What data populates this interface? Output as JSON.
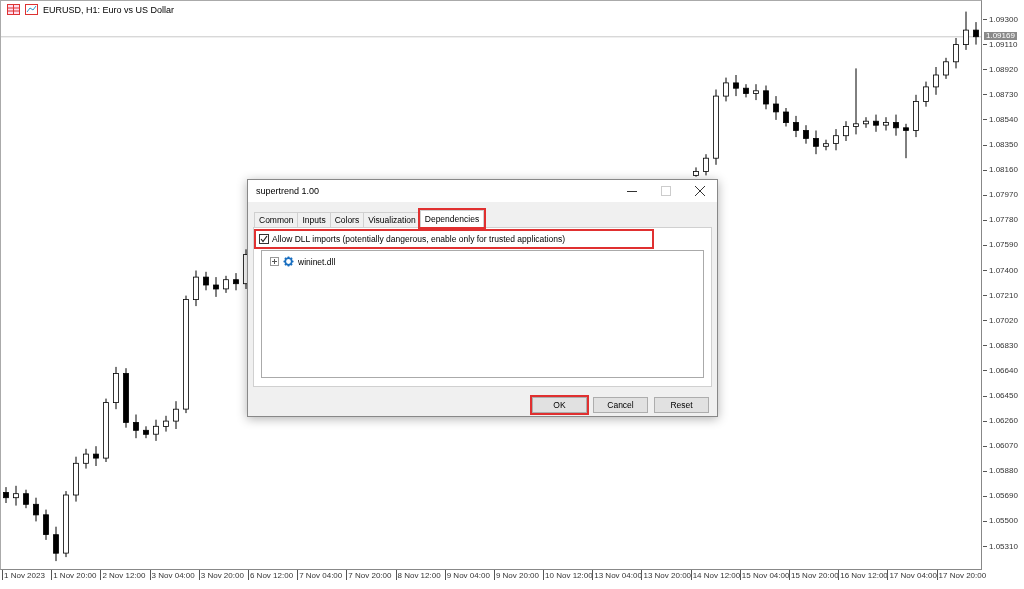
{
  "chart": {
    "title": "EURUSD, H1:  Euro vs US Dollar",
    "price_axis": {
      "current_price": "1.09169"
    },
    "time_axis": {
      "labels": [
        "1 Nov 2023",
        "1 Nov 20:00",
        "2 Nov 12:00",
        "3 Nov 04:00",
        "3 Nov 20:00",
        "6 Nov 12:00",
        "7 Nov 04:00",
        "7 Nov 20:00",
        "8 Nov 12:00",
        "9 Nov 04:00",
        "9 Nov 20:00",
        "10 Nov 12:00",
        "13 Nov 04:00",
        "13 Nov 20:00",
        "14 Nov 12:00",
        "15 Nov 04:00",
        "15 Nov 20:00",
        "16 Nov 12:00",
        "17 Nov 04:00",
        "17 Nov 20:00"
      ]
    },
    "chart_data": {
      "type": "candlestick",
      "ylim": [
        1.0514,
        1.0944
      ],
      "ref_lines": [
        {
          "axis": "y",
          "value": 1.09169
        }
      ],
      "yticks": [
        {
          "value": 1.093,
          "label": "1.09300"
        },
        {
          "value": 1.0911,
          "label": "1.09110"
        },
        {
          "value": 1.0892,
          "label": "1.08920"
        },
        {
          "value": 1.0873,
          "label": "1.08730"
        },
        {
          "value": 1.0854,
          "label": "1.08540"
        },
        {
          "value": 1.0835,
          "label": "1.08350"
        },
        {
          "value": 1.0816,
          "label": "1.08160"
        },
        {
          "value": 1.0797,
          "label": "1.07970"
        },
        {
          "value": 1.0778,
          "label": "1.07780"
        },
        {
          "value": 1.0759,
          "label": "1.07590"
        },
        {
          "value": 1.074,
          "label": "1.07400"
        },
        {
          "value": 1.0721,
          "label": "1.07210"
        },
        {
          "value": 1.0702,
          "label": "1.07020"
        },
        {
          "value": 1.0683,
          "label": "1.06830"
        },
        {
          "value": 1.0664,
          "label": "1.06640"
        },
        {
          "value": 1.0645,
          "label": "1.06450"
        },
        {
          "value": 1.0626,
          "label": "1.06260"
        },
        {
          "value": 1.0607,
          "label": "1.06070"
        },
        {
          "value": 1.0588,
          "label": "1.05880"
        },
        {
          "value": 1.0569,
          "label": "1.05690"
        },
        {
          "value": 1.055,
          "label": "1.05500"
        },
        {
          "value": 1.0531,
          "label": "1.05310"
        }
      ],
      "categories": [
        null,
        null,
        null,
        null,
        null,
        null,
        null,
        null,
        null,
        null,
        null,
        null,
        null,
        null,
        null,
        null,
        null,
        null,
        null,
        null,
        null,
        null,
        null,
        null,
        null,
        null,
        null,
        null,
        null,
        null,
        null,
        null,
        null,
        null,
        null,
        null,
        null,
        null,
        null,
        null,
        null,
        null,
        null,
        null,
        null,
        null,
        null,
        null,
        null,
        null,
        null,
        null,
        null,
        null,
        null,
        null,
        null,
        null,
        null,
        null,
        null,
        null,
        null,
        null,
        null,
        null,
        null,
        null,
        null,
        null,
        null,
        null,
        null,
        null,
        null,
        null,
        null,
        null,
        null,
        null,
        null,
        null,
        null,
        null,
        null,
        null,
        null,
        null,
        null,
        null,
        null,
        null,
        null,
        null,
        null,
        null,
        null,
        null
      ],
      "ohlc": [
        [
          1.0572,
          1.0576,
          1.0564,
          1.0568
        ],
        [
          1.0568,
          1.0577,
          1.0562,
          1.0571
        ],
        [
          1.0571,
          1.0574,
          1.056,
          1.0563
        ],
        [
          1.0563,
          1.0568,
          1.055,
          1.0555
        ],
        [
          1.0555,
          1.0559,
          1.0536,
          1.054
        ],
        [
          1.054,
          1.0546,
          1.052,
          1.0526
        ],
        [
          1.0526,
          1.0573,
          1.0523,
          1.057
        ],
        [
          1.057,
          1.0599,
          1.0565,
          1.0594
        ],
        [
          1.0594,
          1.0605,
          1.059,
          1.0601
        ],
        [
          1.0601,
          1.0607,
          1.0592,
          1.0598
        ],
        [
          1.0598,
          1.0643,
          1.0595,
          1.064
        ],
        [
          1.064,
          1.0667,
          1.0635,
          1.0662
        ],
        [
          1.0662,
          1.0666,
          1.0621,
          1.0625
        ],
        [
          1.0625,
          1.0631,
          1.0613,
          1.0619
        ],
        [
          1.0619,
          1.0622,
          1.0613,
          1.0616
        ],
        [
          1.0616,
          1.0627,
          1.0611,
          1.0622
        ],
        [
          1.0622,
          1.063,
          1.0618,
          1.0626
        ],
        [
          1.0626,
          1.0641,
          1.062,
          1.0635
        ],
        [
          1.0635,
          1.0721,
          1.0632,
          1.0718
        ],
        [
          1.0718,
          1.074,
          1.0713,
          1.0735
        ],
        [
          1.0735,
          1.0739,
          1.0725,
          1.0729
        ],
        [
          1.0729,
          1.0735,
          1.072,
          1.0726
        ],
        [
          1.0726,
          1.0736,
          1.0723,
          1.0733
        ],
        [
          1.0733,
          1.0738,
          1.0725,
          1.073
        ],
        [
          1.073,
          1.0756,
          1.0726,
          1.0752
        ],
        null,
        null,
        null,
        null,
        null,
        null,
        null,
        null,
        null,
        null,
        null,
        null,
        null,
        null,
        null,
        null,
        null,
        null,
        null,
        null,
        null,
        null,
        null,
        null,
        null,
        null,
        null,
        null,
        null,
        null,
        null,
        null,
        null,
        null,
        null,
        null,
        null,
        null,
        null,
        null,
        null,
        null,
        null,
        null,
        [
          1.0812,
          1.0818,
          1.0811,
          1.0815
        ],
        [
          1.0815,
          1.0828,
          1.0812,
          1.0825
        ],
        [
          1.0825,
          1.0877,
          1.082,
          1.0872
        ],
        [
          1.0872,
          1.0886,
          1.0868,
          1.0882
        ],
        [
          1.0882,
          1.0888,
          1.0872,
          1.0878
        ],
        [
          1.0878,
          1.0881,
          1.0871,
          1.0874
        ],
        [
          1.0874,
          1.0881,
          1.0869,
          1.0876
        ],
        [
          1.0876,
          1.088,
          1.0862,
          1.0866
        ],
        [
          1.0866,
          1.0872,
          1.0854,
          1.086
        ],
        [
          1.086,
          1.0863,
          1.0849,
          1.0852
        ],
        [
          1.0852,
          1.0857,
          1.0841,
          1.0846
        ],
        [
          1.0846,
          1.085,
          1.0836,
          1.084
        ],
        [
          1.084,
          1.0846,
          1.0828,
          1.0834
        ],
        [
          1.0834,
          1.0839,
          1.0831,
          1.0836
        ],
        [
          1.0836,
          1.0847,
          1.0831,
          1.0842
        ],
        [
          1.0842,
          1.0853,
          1.0838,
          1.0849
        ],
        [
          1.0849,
          1.0893,
          1.0843,
          1.0851
        ],
        [
          1.0851,
          1.0856,
          1.0848,
          1.0853
        ],
        [
          1.0853,
          1.0858,
          1.0845,
          1.085
        ],
        [
          1.085,
          1.0856,
          1.0846,
          1.0852
        ],
        [
          1.0852,
          1.0858,
          1.0842,
          1.0848
        ],
        [
          1.0848,
          1.0851,
          1.0825,
          1.0846
        ],
        [
          1.0846,
          1.0873,
          1.0841,
          1.0868
        ],
        [
          1.0868,
          1.0883,
          1.0864,
          1.0879
        ],
        [
          1.0879,
          1.0894,
          1.0873,
          1.0888
        ],
        [
          1.0888,
          1.0901,
          1.0885,
          1.0898
        ],
        [
          1.0898,
          1.0916,
          1.0893,
          1.0911
        ],
        [
          1.0911,
          1.0936,
          1.0907,
          1.0922
        ],
        [
          1.0922,
          1.0928,
          1.0911,
          1.0917
        ]
      ]
    }
  },
  "dialog": {
    "title": "supertrend 1.00",
    "tabs": [
      {
        "label": "Common",
        "selected": false,
        "highlighted": false
      },
      {
        "label": "Inputs",
        "selected": false,
        "highlighted": false
      },
      {
        "label": "Colors",
        "selected": false,
        "highlighted": false
      },
      {
        "label": "Visualization",
        "selected": false,
        "highlighted": false
      },
      {
        "label": "Dependencies",
        "selected": true,
        "highlighted": true
      }
    ],
    "allow_dll": {
      "label": "Allow DLL imports (potentially dangerous, enable only for trusted applications)",
      "checked": true,
      "highlighted": true
    },
    "tree": [
      {
        "label": "wininet.dll",
        "expanded": false
      }
    ],
    "buttons": [
      {
        "label": "OK",
        "highlighted": true
      },
      {
        "label": "Cancel",
        "highlighted": false
      },
      {
        "label": "Reset",
        "highlighted": false
      }
    ]
  }
}
